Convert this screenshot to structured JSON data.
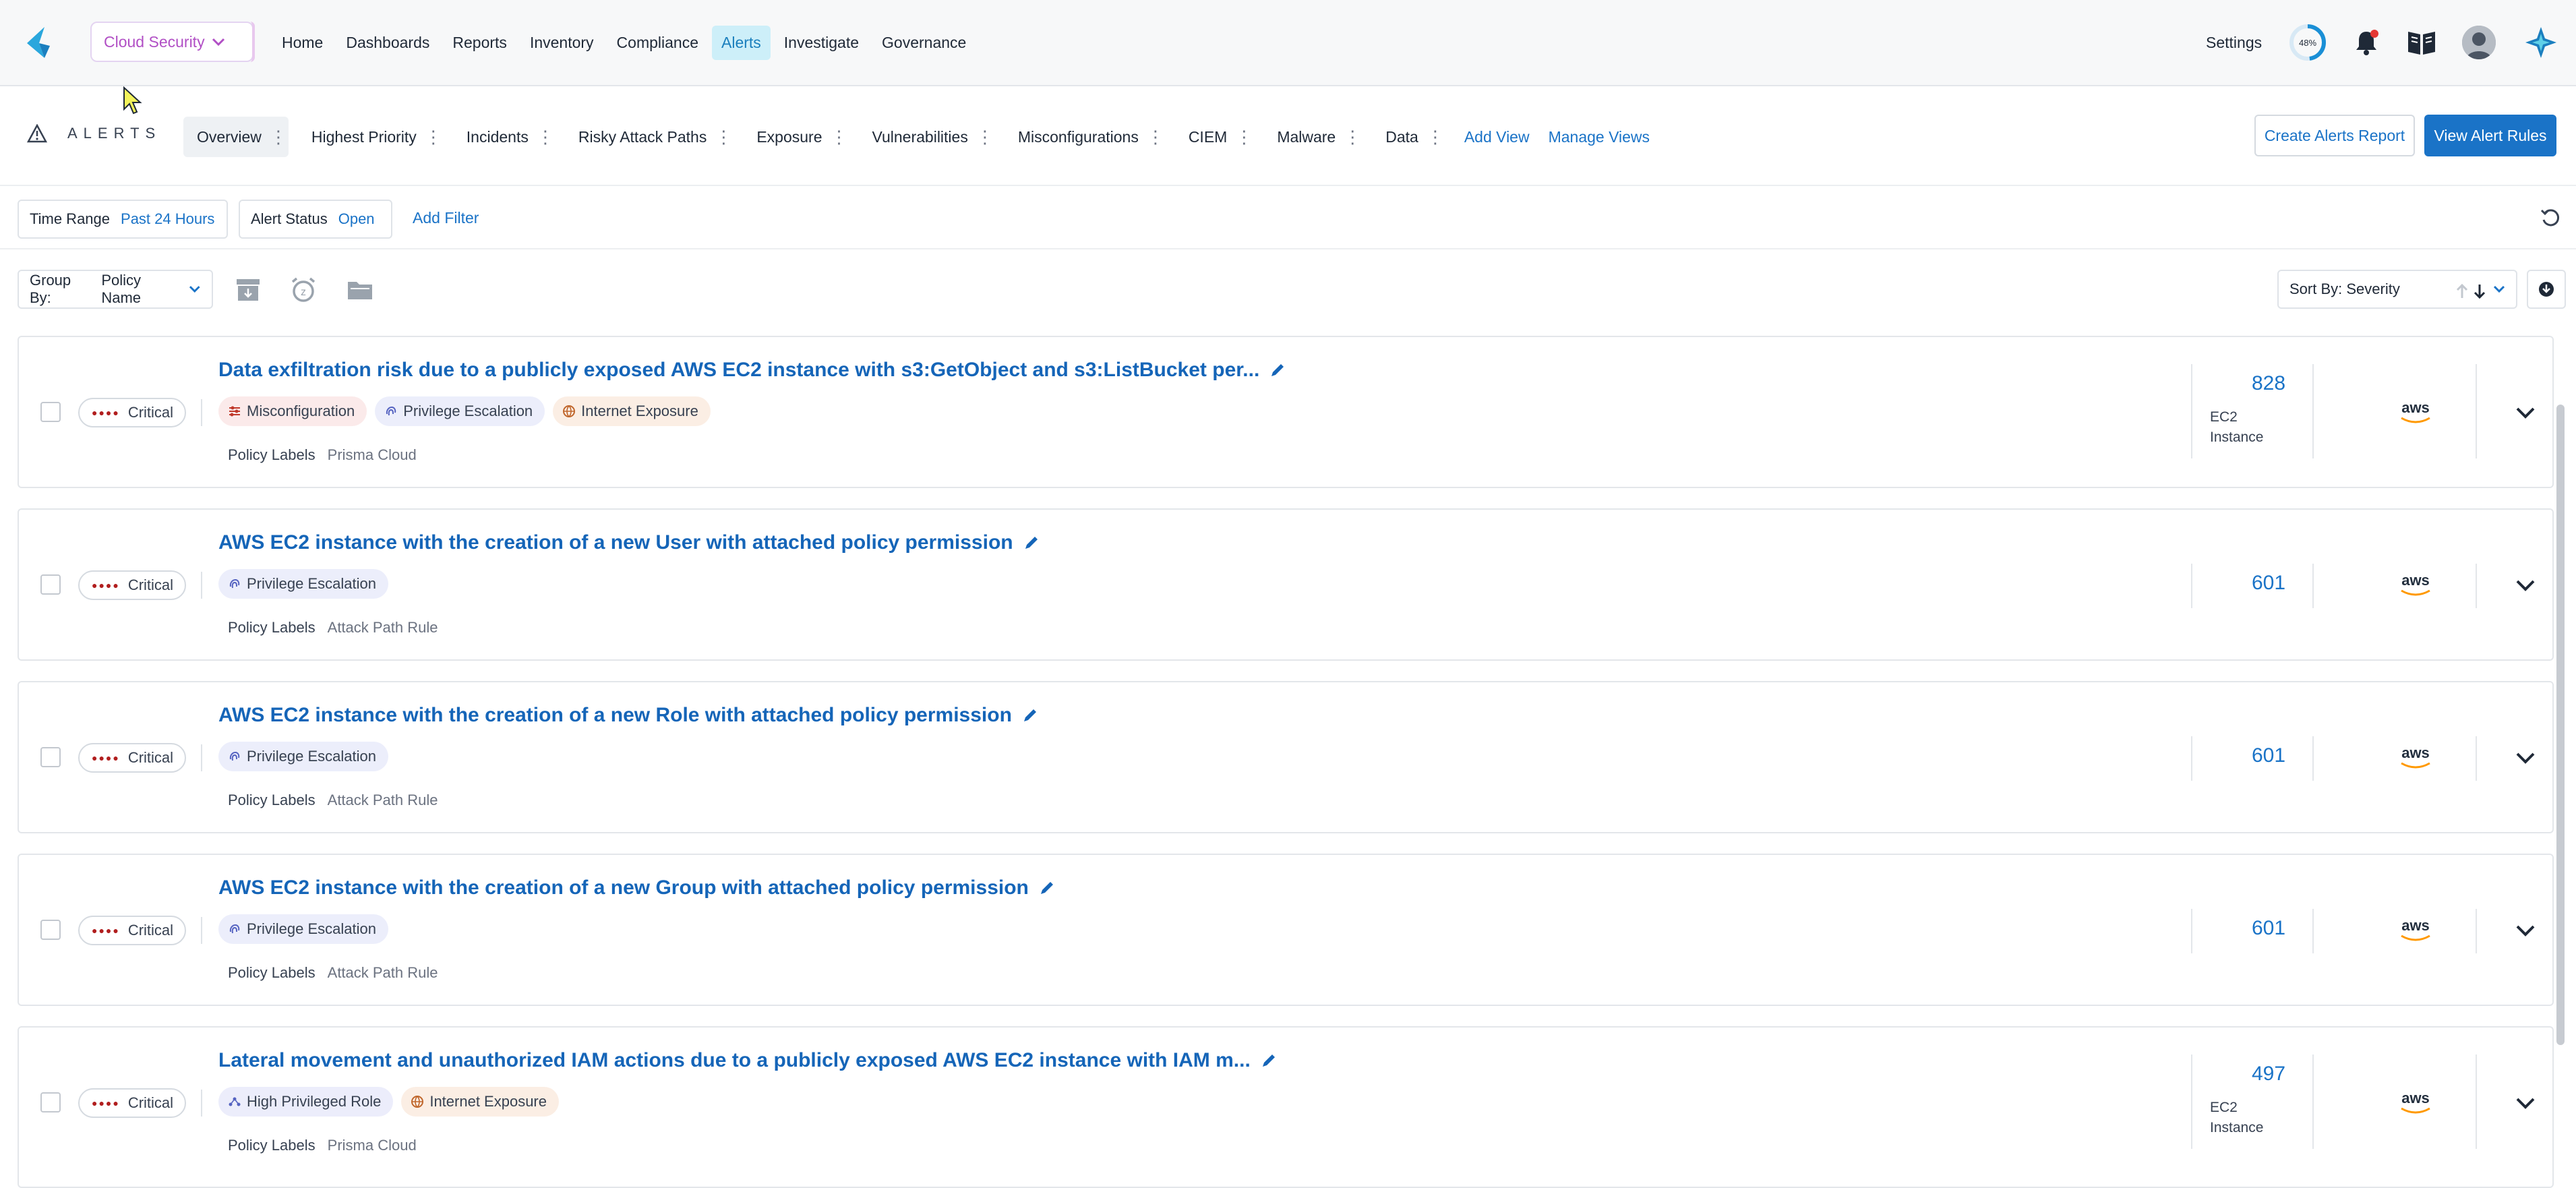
{
  "topnav": {
    "product": "Cloud Security",
    "items": [
      "Home",
      "Dashboards",
      "Reports",
      "Inventory",
      "Compliance",
      "Alerts",
      "Investigate",
      "Governance"
    ],
    "active": "Alerts",
    "settings": "Settings",
    "progress_label": "48%",
    "progress": 0.48,
    "icons": [
      "notification-bell-icon",
      "book-icon",
      "user-avatar",
      "ai-sparkle-icon"
    ]
  },
  "alerts_header": {
    "title": "ALERTS",
    "tabs": [
      "Overview",
      "Highest Priority",
      "Incidents",
      "Risky Attack Paths",
      "Exposure",
      "Vulnerabilities",
      "Misconfigurations",
      "CIEM",
      "Malware",
      "Data"
    ],
    "add_view": "Add View",
    "manage_views": "Manage Views",
    "create_report": "Create Alerts Report",
    "view_rules": "View Alert Rules"
  },
  "filters": {
    "time_range_label": "Time Range",
    "time_range_value": "Past 24 Hours",
    "status_label": "Alert Status",
    "status_value": "Open",
    "add_filter": "Add Filter"
  },
  "grouping": {
    "group_by_label": "Group By:",
    "group_by_value": "Policy Name",
    "sort_by": "Sort By: Severity"
  },
  "alerts": [
    {
      "severity": "Critical",
      "title": "Data exfiltration risk due to a publicly exposed AWS EC2 instance with s3:GetObject and s3:ListBucket per...",
      "tags": [
        "Misconfiguration",
        "Privilege Escalation",
        "Internet Exposure"
      ],
      "policy_labels_key": "Policy Labels",
      "policy_labels": "Prisma Cloud",
      "count": "828",
      "resource_type": [
        "EC2",
        "Instance"
      ],
      "cloud": "aws"
    },
    {
      "severity": "Critical",
      "title": "AWS EC2 instance with the creation of a new User with attached policy permission",
      "tags": [
        "Privilege Escalation"
      ],
      "policy_labels_key": "Policy Labels",
      "policy_labels": "Attack Path Rule",
      "count": "601",
      "cloud": "aws"
    },
    {
      "severity": "Critical",
      "title": "AWS EC2 instance with the creation of a new Role with attached policy permission",
      "tags": [
        "Privilege Escalation"
      ],
      "policy_labels_key": "Policy Labels",
      "policy_labels": "Attack Path Rule",
      "count": "601",
      "cloud": "aws"
    },
    {
      "severity": "Critical",
      "title": "AWS EC2 instance with the creation of a new Group with attached policy permission",
      "tags": [
        "Privilege Escalation"
      ],
      "policy_labels_key": "Policy Labels",
      "policy_labels": "Attack Path Rule",
      "count": "601",
      "cloud": "aws"
    },
    {
      "severity": "Critical",
      "title": "Lateral movement and unauthorized IAM actions due to a publicly exposed AWS EC2 instance with IAM m...",
      "tags": [
        "High Privileged Role",
        "Internet Exposure"
      ],
      "policy_labels_key": "Policy Labels",
      "policy_labels": "Prisma Cloud",
      "count": "497",
      "resource_type": [
        "EC2",
        "Instance"
      ],
      "cloud": "aws"
    }
  ]
}
